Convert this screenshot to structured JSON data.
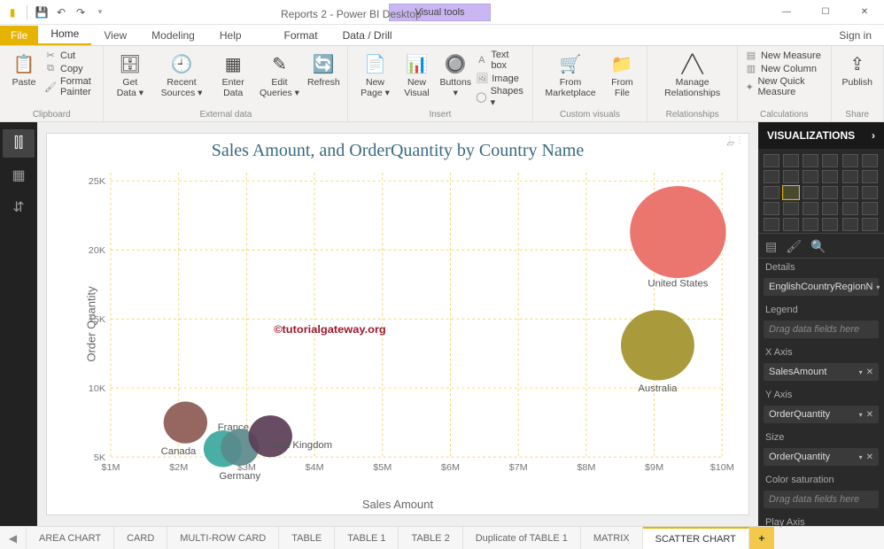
{
  "titlebar": {
    "visual_tools": "Visual tools",
    "app_title": "Reports 2 - Power BI Desktop"
  },
  "tabs": {
    "file": "File",
    "home": "Home",
    "view": "View",
    "modeling": "Modeling",
    "help": "Help",
    "format": "Format",
    "datadrill": "Data / Drill",
    "signin": "Sign in"
  },
  "ribbon": {
    "clipboard": {
      "label": "Clipboard",
      "paste": "Paste",
      "cut": "Cut",
      "copy": "Copy",
      "fmt": "Format Painter"
    },
    "external": {
      "label": "External data",
      "getdata": "Get\nData ▾",
      "recent": "Recent\nSources ▾",
      "enter": "Enter\nData",
      "edit": "Edit\nQueries ▾",
      "refresh": "Refresh"
    },
    "insert": {
      "label": "Insert",
      "newpage": "New\nPage ▾",
      "newvisual": "New\nVisual",
      "buttons": "Buttons\n▾",
      "textbox": "Text box",
      "image": "Image",
      "shapes": "Shapes ▾"
    },
    "custom": {
      "label": "Custom visuals",
      "market": "From\nMarketplace",
      "file": "From\nFile"
    },
    "rel": {
      "label": "Relationships",
      "manage": "Manage\nRelationships"
    },
    "calc": {
      "label": "Calculations",
      "newmeasure": "New Measure",
      "newcolumn": "New Column",
      "newquick": "New Quick Measure"
    },
    "share": {
      "label": "Share",
      "publish": "Publish"
    }
  },
  "viz": {
    "header": "VISUALIZATIONS",
    "details_label": "Details",
    "details_field": "EnglishCountryRegionN",
    "legend_label": "Legend",
    "legend_placeholder": "Drag data fields here",
    "xaxis_label": "X Axis",
    "xaxis_field": "SalesAmount",
    "yaxis_label": "Y Axis",
    "yaxis_field": "OrderQuantity",
    "size_label": "Size",
    "size_field": "OrderQuantity",
    "colorsat_label": "Color saturation",
    "colorsat_placeholder": "Drag data fields here",
    "playaxis_label": "Play Axis"
  },
  "page_tabs": [
    "AREA CHART",
    "CARD",
    "MULTI-ROW CARD",
    "TABLE",
    "TABLE 1",
    "TABLE 2",
    "Duplicate of TABLE 1",
    "MATRIX",
    "SCATTER CHART"
  ],
  "chart_data": {
    "type": "scatter",
    "title": "Sales Amount, and OrderQuantity by Country Name",
    "xlabel": "Sales Amount",
    "ylabel": "Order Quantity",
    "xlim": [
      1000000,
      10000000
    ],
    "ylim": [
      5000,
      25000
    ],
    "x_ticks": [
      "$1M",
      "$2M",
      "$3M",
      "$4M",
      "$5M",
      "$6M",
      "$7M",
      "$8M",
      "$9M",
      "$10M"
    ],
    "y_ticks": [
      "5K",
      "10K",
      "15K",
      "20K",
      "25K"
    ],
    "watermark": "©tutorialgateway.org",
    "series": [
      {
        "name": "Canada",
        "x": 2100000,
        "y": 7500,
        "size": 25,
        "color": "#8c5a53"
      },
      {
        "name": "France",
        "x": 2650000,
        "y": 5600,
        "size": 22,
        "color": "#3aa89e"
      },
      {
        "name": "Germany",
        "x": 2900000,
        "y": 5700,
        "size": 22,
        "color": "#5a8a8c"
      },
      {
        "name": "United Kingdom",
        "x": 3350000,
        "y": 6500,
        "size": 25,
        "color": "#5a3d57"
      },
      {
        "name": "Australia",
        "x": 9050000,
        "y": 13100,
        "size": 42,
        "color": "#a2922b"
      },
      {
        "name": "United States",
        "x": 9350000,
        "y": 21300,
        "size": 55,
        "color": "#e86a63"
      }
    ]
  }
}
